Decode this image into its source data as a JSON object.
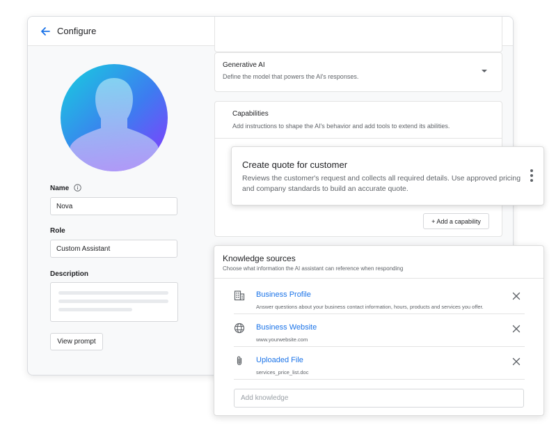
{
  "header": {
    "title": "Configure"
  },
  "profile": {
    "name_label": "Name",
    "name_value": "Nova",
    "role_label": "Role",
    "role_value": "Custom Assistant",
    "description_label": "Description",
    "view_prompt_label": "View prompt"
  },
  "generative_ai": {
    "title": "Generative AI",
    "subtitle": "Define the model that powers the AI's responses."
  },
  "capabilities": {
    "title": "Capabilities",
    "subtitle": "Add instructions to shape the AI's behavior and add tools to extend its abilities.",
    "items": [
      {
        "title": "Create quote for customer",
        "description": "Reviews the customer's request and collects all required details. Use approved pricing and company standards to build an accurate quote."
      }
    ],
    "add_label": "+ Add a capability"
  },
  "knowledge": {
    "title": "Knowledge sources",
    "subtitle": "Choose what information the AI assistant can reference when responding",
    "items": [
      {
        "icon": "building-icon",
        "name": "Business Profile",
        "detail": "Answer questions about your business contact information, hours, products and services you offer."
      },
      {
        "icon": "globe-icon",
        "name": "Business Website",
        "detail": "www.yourwebsite.com"
      },
      {
        "icon": "paperclip-icon",
        "name": "Uploaded File",
        "detail": "services_price_list.doc"
      }
    ],
    "add_placeholder": "Add knowledge"
  },
  "colors": {
    "accent": "#1a73e8",
    "avatar_gradient_start": "#1fc8e3",
    "avatar_gradient_end": "#8a3cff"
  }
}
